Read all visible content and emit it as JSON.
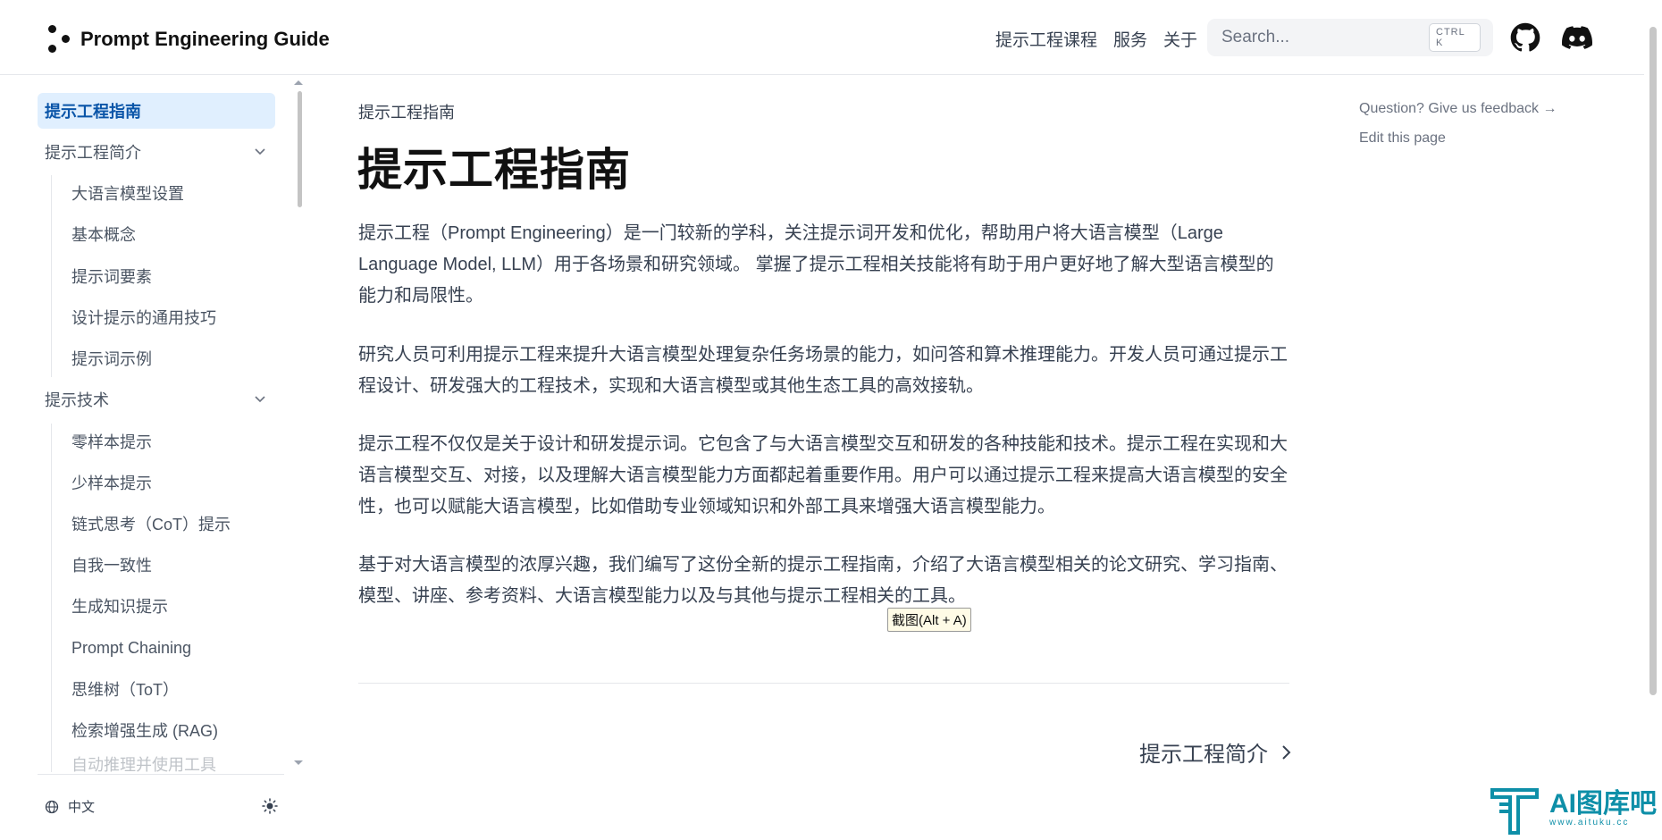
{
  "header": {
    "site_title": "Prompt Engineering Guide",
    "nav": [
      "提示工程课程",
      "服务",
      "关于"
    ],
    "search_placeholder": "Search...",
    "search_shortcut": "CTRL K",
    "icons": [
      "github-icon",
      "discord-icon"
    ]
  },
  "sidebar": {
    "active": "提示工程指南",
    "section1": {
      "label": "提示工程简介",
      "items": [
        "大语言模型设置",
        "基本概念",
        "提示词要素",
        "设计提示的通用技巧",
        "提示词示例"
      ]
    },
    "section2": {
      "label": "提示技术",
      "items": [
        "零样本提示",
        "少样本提示",
        "链式思考（CoT）提示",
        "自我一致性",
        "生成知识提示",
        "Prompt Chaining",
        "思维树（ToT）",
        "检索增强生成 (RAG)",
        "自动推理并使用工具"
      ]
    },
    "language": "中文"
  },
  "main": {
    "breadcrumb": "提示工程指南",
    "title": "提示工程指南",
    "paragraphs": [
      "提示工程（Prompt Engineering）是一门较新的学科，关注提示词开发和优化，帮助用户将大语言模型（Large Language Model, LLM）用于各场景和研究领域。 掌握了提示工程相关技能将有助于用户更好地了解大型语言模型的能力和局限性。",
      "研究人员可利用提示工程来提升大语言模型处理复杂任务场景的能力，如问答和算术推理能力。开发人员可通过提示工程设计、研发强大的工程技术，实现和大语言模型或其他生态工具的高效接轨。",
      "提示工程不仅仅是关于设计和研发提示词。它包含了与大语言模型交互和研发的各种技能和技术。提示工程在实现和大语言模型交互、对接，以及理解大语言模型能力方面都起着重要作用。用户可以通过提示工程来提高大语言模型的安全性，也可以赋能大语言模型，比如借助专业领域知识和外部工具来增强大语言模型能力。",
      "基于对大语言模型的浓厚兴趣，我们编写了这份全新的提示工程指南，介绍了大语言模型相关的论文研究、学习指南、模型、讲座、参考资料、大语言模型能力以及与其他与提示工程相关的工具。"
    ],
    "next_link": "提示工程简介"
  },
  "tooltip": "截图(Alt + A)",
  "toc": {
    "feedback": "Question? Give us feedback →",
    "edit": "Edit this page"
  },
  "watermark": {
    "title": "AI图库吧",
    "url": "www.aituku.cc"
  }
}
